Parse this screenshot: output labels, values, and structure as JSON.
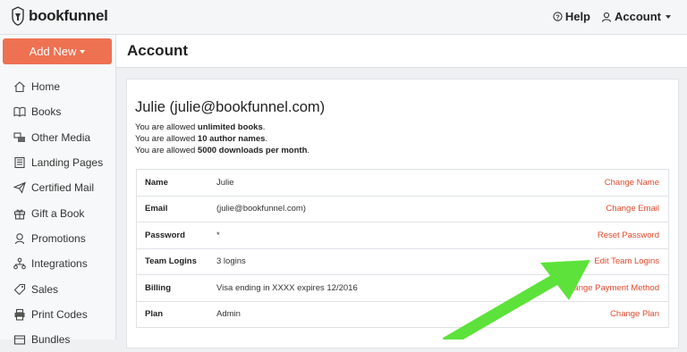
{
  "topbar": {
    "logo_text": "bookfunnel",
    "help_label": "Help",
    "account_label": "Account"
  },
  "sidebar": {
    "add_new_label": "Add New",
    "items": [
      {
        "label": "Home",
        "icon": "home-icon"
      },
      {
        "label": "Books",
        "icon": "book-icon"
      },
      {
        "label": "Other Media",
        "icon": "media-icon"
      },
      {
        "label": "Landing Pages",
        "icon": "landing-pages-icon"
      },
      {
        "label": "Certified Mail",
        "icon": "paper-plane-icon"
      },
      {
        "label": "Gift a Book",
        "icon": "gift-icon"
      },
      {
        "label": "Promotions",
        "icon": "promotions-icon"
      },
      {
        "label": "Integrations",
        "icon": "integrations-icon"
      },
      {
        "label": "Sales",
        "icon": "tag-icon"
      },
      {
        "label": "Print Codes",
        "icon": "printer-icon"
      },
      {
        "label": "Bundles",
        "icon": "bundles-icon"
      }
    ]
  },
  "page": {
    "title": "Account"
  },
  "account": {
    "user_first": "Julie",
    "user_email_paren": "(julie@bookfunnel.com)",
    "allow_prefix": "You are allowed",
    "allowances": [
      {
        "value": "unlimited books"
      },
      {
        "value": "10 author names"
      },
      {
        "value": "5000 downloads per month"
      }
    ],
    "rows": [
      {
        "label": "Name",
        "value": "Julie",
        "action": "Change Name"
      },
      {
        "label": "Email",
        "value": "(julie@bookfunnel.com)",
        "action": "Change Email"
      },
      {
        "label": "Password",
        "value": "*",
        "action": "Reset Password"
      },
      {
        "label": "Team Logins",
        "value": "3 logins",
        "action": "Edit Team Logins"
      },
      {
        "label": "Billing",
        "value": "Visa ending in XXXX expires 12/2016",
        "action": "Change Payment Method"
      },
      {
        "label": "Plan",
        "value": "Admin",
        "action": "Change Plan"
      }
    ]
  },
  "colors": {
    "accent": "#ee7152",
    "link": "#e2492c",
    "arrow": "#5ce23a"
  }
}
